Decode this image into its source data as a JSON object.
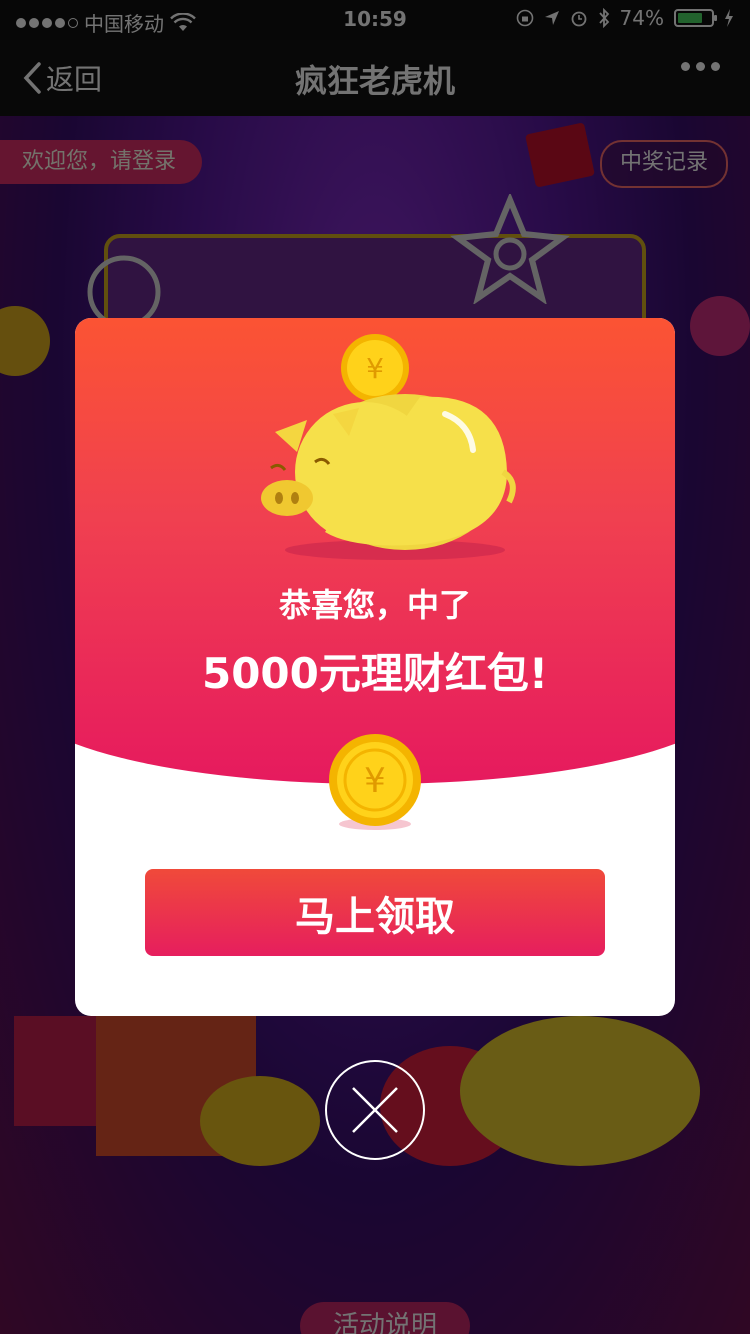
{
  "status_bar": {
    "carrier": "中国移动",
    "time": "10:59",
    "battery_percent_label": "74%",
    "battery_level": 0.74
  },
  "nav": {
    "back_label": "返回",
    "title": "疯狂老虎机"
  },
  "background": {
    "welcome": "欢迎您，请登录",
    "records": "中奖记录",
    "activity": "活动说明"
  },
  "modal": {
    "line1": "恭喜您，中了",
    "line2": "5000元理财红包!",
    "claim_button": "马上领取"
  },
  "colors": {
    "modal_gradient_top": "#ff5a2a",
    "modal_gradient_bottom": "#e61a5e",
    "coin": "#ffd21a",
    "pig": "#f6e04a"
  }
}
